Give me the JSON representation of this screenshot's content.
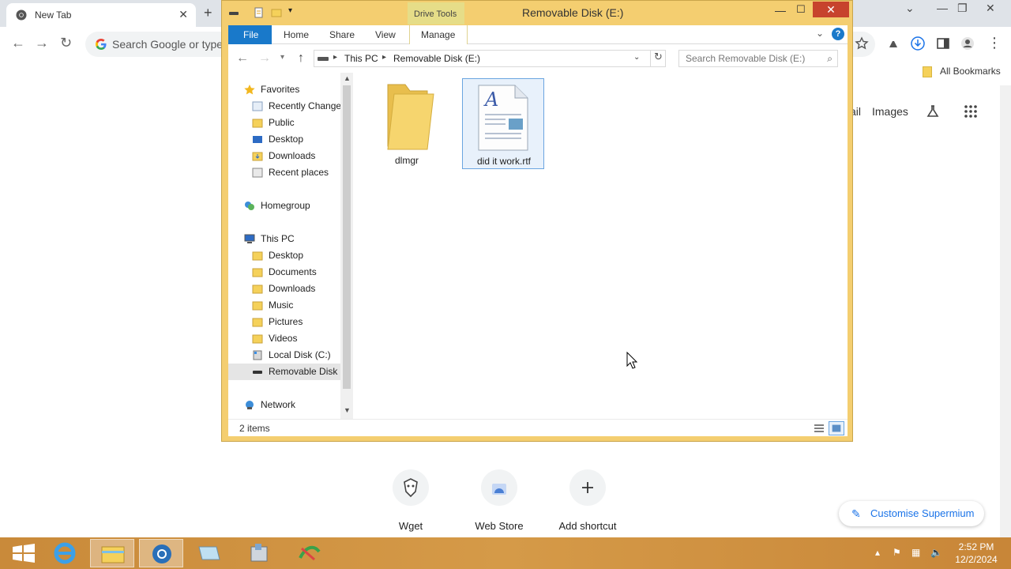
{
  "browser": {
    "tab_title": "New Tab",
    "new_tab_symbol": "+",
    "omnibox_placeholder": "Search Google or type a URL",
    "bookmarks_label": "All Bookmarks",
    "top_right_gmail_fragment": "ail",
    "top_right_images": "Images",
    "shortcuts": [
      {
        "label": "Wget",
        "icon": "wget-icon"
      },
      {
        "label": "Web Store",
        "icon": "web-store-icon"
      },
      {
        "label": "Add shortcut",
        "icon": "plus-icon"
      }
    ],
    "customise_label": "Customise Supermium"
  },
  "explorer": {
    "window_title": "Removable Disk (E:)",
    "context_tab_group": "Drive Tools",
    "ribbon_tabs": [
      "File",
      "Home",
      "Share",
      "View",
      "Manage"
    ],
    "breadcrumb": [
      "This PC",
      "Removable Disk (E:)"
    ],
    "search_placeholder": "Search Removable Disk (E:)",
    "nav": {
      "favorites": "Favorites",
      "recently_changed": "Recently Changed",
      "public": "Public",
      "desktop": "Desktop",
      "downloads": "Downloads",
      "recent_places": "Recent places",
      "homegroup": "Homegroup",
      "this_pc": "This PC",
      "pc_desktop": "Desktop",
      "pc_documents": "Documents",
      "pc_downloads": "Downloads",
      "pc_music": "Music",
      "pc_pictures": "Pictures",
      "pc_videos": "Videos",
      "local_disk": "Local Disk (C:)",
      "removable_disk": "Removable Disk (E:)",
      "network": "Network"
    },
    "files": [
      {
        "name": "dlmgr",
        "type": "folder",
        "selected": false
      },
      {
        "name": "did it work.rtf",
        "type": "rtf-document",
        "selected": true
      }
    ],
    "status_count": "2 items",
    "accent_color": "#f4ce70",
    "file_tab_color": "#1979ca",
    "close_button_color": "#c7432d"
  },
  "taskbar": {
    "apps": [
      "start-icon",
      "internet-explorer-icon",
      "file-explorer-icon",
      "browser-icon",
      "notepad-icon",
      "installer-icon",
      "app-icon"
    ],
    "time": "2:52 PM",
    "date": "12/2/2024"
  }
}
